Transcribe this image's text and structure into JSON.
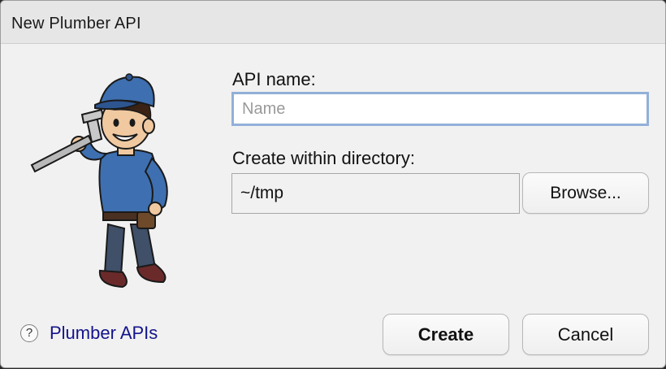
{
  "dialog": {
    "title": "New Plumber API"
  },
  "mascot": {
    "icon": "plumber-mascot-icon"
  },
  "form": {
    "api_name_label": "API name:",
    "api_name_value": "",
    "api_name_placeholder": "Name",
    "directory_label": "Create within directory:",
    "directory_value": "~/tmp",
    "browse_label": "Browse..."
  },
  "footer": {
    "help_icon_glyph": "?",
    "help_link_label": "Plumber APIs",
    "create_label": "Create",
    "cancel_label": "Cancel"
  },
  "colors": {
    "focus_border": "#92b0d8",
    "link": "#14148c",
    "dialog_bg": "#f1f1f1"
  }
}
